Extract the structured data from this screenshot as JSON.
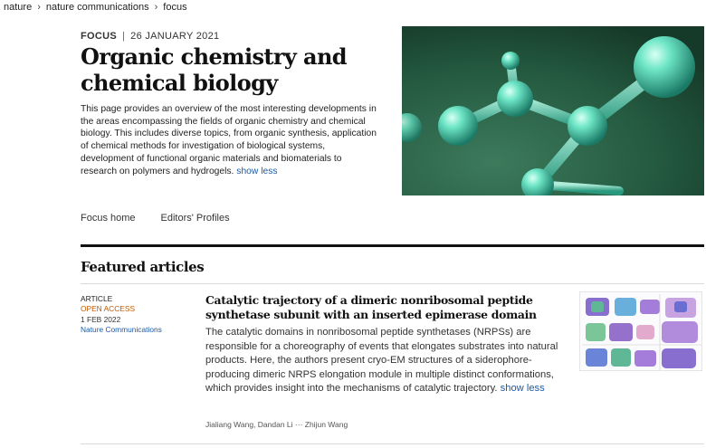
{
  "breadcrumb": {
    "items": [
      "nature",
      "nature communications",
      "focus"
    ]
  },
  "header": {
    "type": "FOCUS",
    "date": "26 JANUARY 2021",
    "title": "Organic chemistry and chemical biology",
    "description": "This page provides an overview of the most interesting developments in the areas encompassing the fields of organic chemistry and chemical biology. This includes diverse topics, from organic synthesis, application of chemical methods for investigation of biological systems, development of functional organic materials and biomaterials to research on polymers and hydrogels.",
    "show_less": "show less"
  },
  "tabs": [
    "Focus home",
    "Editors' Profiles"
  ],
  "featured": {
    "heading": "Featured articles",
    "articles": [
      {
        "kind": "ARTICLE",
        "access": "OPEN ACCESS",
        "date": "1 FEB 2022",
        "journal": "Nature Communications",
        "title": "Catalytic trajectory of a dimeric nonribosomal peptide synthetase subunit with an inserted epimerase domain",
        "abstract": "The catalytic domains in nonribosomal peptide synthetases (NRPSs) are responsible for a choreography of events that elongates substrates into natural products. Here, the authors present cryo-EM structures of a siderophore-producing dimeric NRPS elongation module in multiple distinct conformations, which provides insight into the mechanisms of catalytic trajectory.",
        "show_less": "show less",
        "authors": "Jialiang Wang, Dandan Li ··· Zhijun Wang"
      }
    ]
  },
  "colors": {
    "link": "#1a5aa8",
    "open_access": "#c25a00",
    "hero_bg": "#1d4a34",
    "molecule": "#4fd1b3"
  },
  "icons": {
    "breadcrumb_separator": "chevron-right-icon"
  }
}
